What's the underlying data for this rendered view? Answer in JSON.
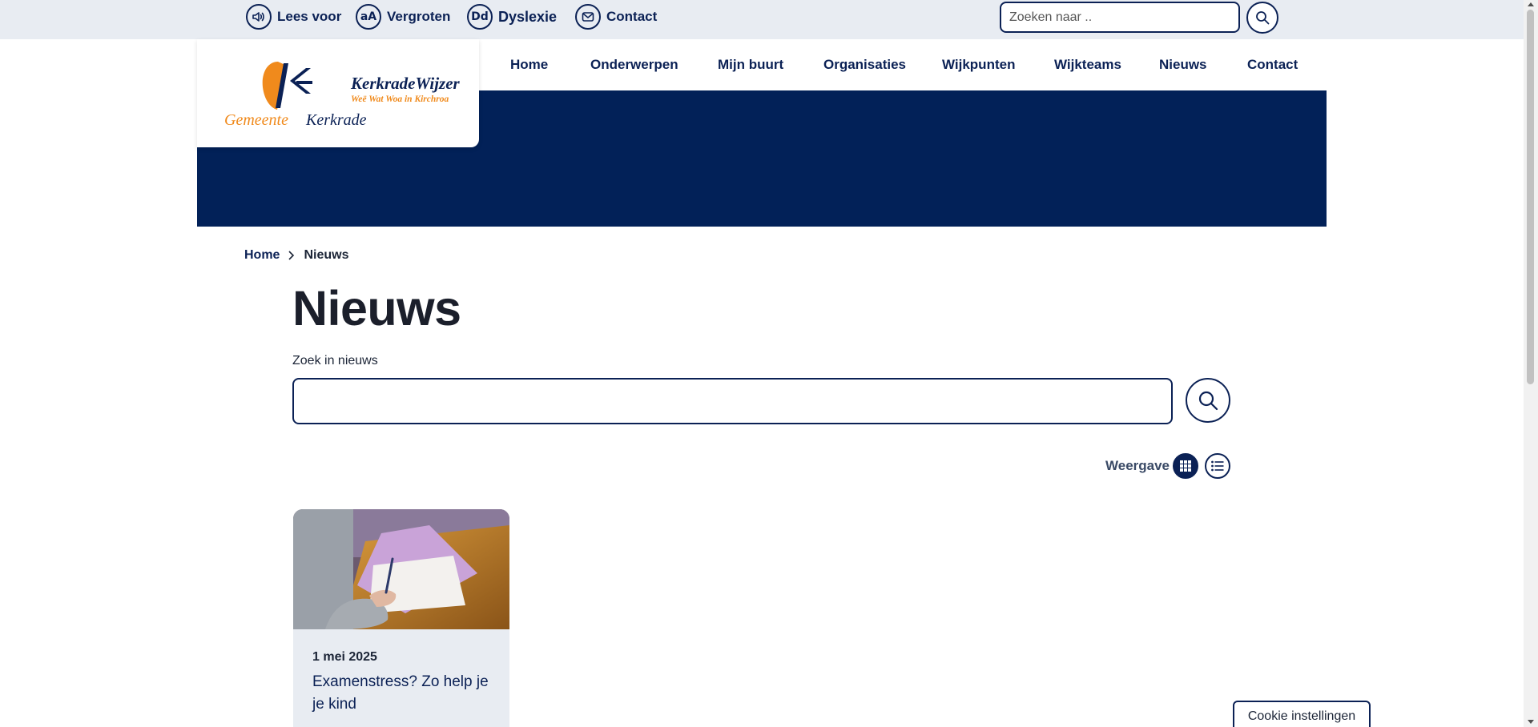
{
  "utility": {
    "read_aloud": "Lees voor",
    "enlarge": "Vergroten",
    "enlarge_glyph": "aA",
    "dyslexia": "Dyslexie",
    "dyslexia_glyph": "Dd",
    "contact": "Contact",
    "search_placeholder": "Zoeken naar .."
  },
  "logo": {
    "brand": "KerkradeWijzer",
    "tagline": "Weë Wat Woa in Kirchroa",
    "municipality_prefix": "Gemeente",
    "municipality_name": "Kerkrade"
  },
  "nav": {
    "items": [
      "Home",
      "Onderwerpen",
      "Mijn buurt",
      "Organisaties",
      "Wijkpunten",
      "Wijkteams",
      "Nieuws",
      "Contact"
    ]
  },
  "breadcrumb": {
    "home": "Home",
    "current": "Nieuws"
  },
  "page": {
    "title": "Nieuws",
    "search_label": "Zoek in nieuws",
    "search_value": "",
    "view_label": "Weergave",
    "active_view": "grid"
  },
  "cards": [
    {
      "date": "1 mei 2025",
      "title": "Examenstress? Zo help je je kind"
    }
  ],
  "cookie": {
    "label": "Cookie instellingen"
  },
  "colors": {
    "navy": "#022158",
    "accent_orange": "#f08a1c",
    "utility_bg": "#e8ecf2"
  }
}
